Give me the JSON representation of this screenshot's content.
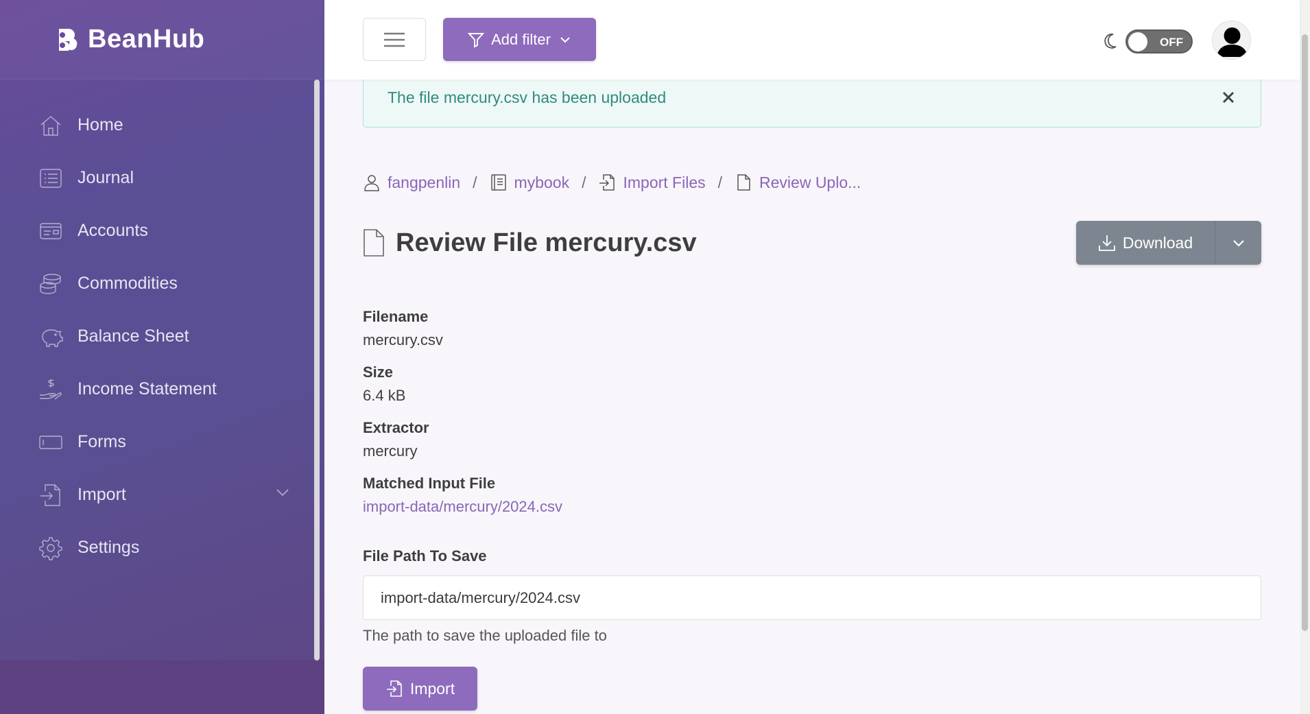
{
  "app": {
    "brand": "BeanHub",
    "accent": "#8e6bbd",
    "sidebar_color": "#5a4f95"
  },
  "sidebar": {
    "items": [
      {
        "label": "Home",
        "icon": "home-icon"
      },
      {
        "label": "Journal",
        "icon": "list-icon"
      },
      {
        "label": "Accounts",
        "icon": "card-icon"
      },
      {
        "label": "Commodities",
        "icon": "coins-icon"
      },
      {
        "label": "Balance Sheet",
        "icon": "piggy-bank-icon"
      },
      {
        "label": "Income Statement",
        "icon": "hand-dollar-icon"
      },
      {
        "label": "Forms",
        "icon": "form-icon"
      },
      {
        "label": "Import",
        "icon": "import-file-icon",
        "expandable": true
      },
      {
        "label": "Settings",
        "icon": "gear-icon"
      }
    ]
  },
  "topbar": {
    "add_filter_label": "Add filter",
    "theme_toggle_state": "OFF"
  },
  "alert": {
    "message": "The file mercury.csv has been uploaded"
  },
  "breadcrumb": {
    "user": "fangpenlin",
    "book": "mybook",
    "section": "Import Files",
    "current": "Review Uplo..."
  },
  "page": {
    "title": "Review File mercury.csv",
    "download_label": "Download"
  },
  "details": {
    "filename_label": "Filename",
    "filename_value": "mercury.csv",
    "size_label": "Size",
    "size_value": "6.4 kB",
    "extractor_label": "Extractor",
    "extractor_value": "mercury",
    "matched_label": "Matched Input File",
    "matched_value": "import-data/mercury/2024.csv"
  },
  "form": {
    "path_label": "File Path To Save",
    "path_value": "import-data/mercury/2024.csv",
    "path_help": "The path to save the uploaded file to",
    "import_label": "Import"
  }
}
